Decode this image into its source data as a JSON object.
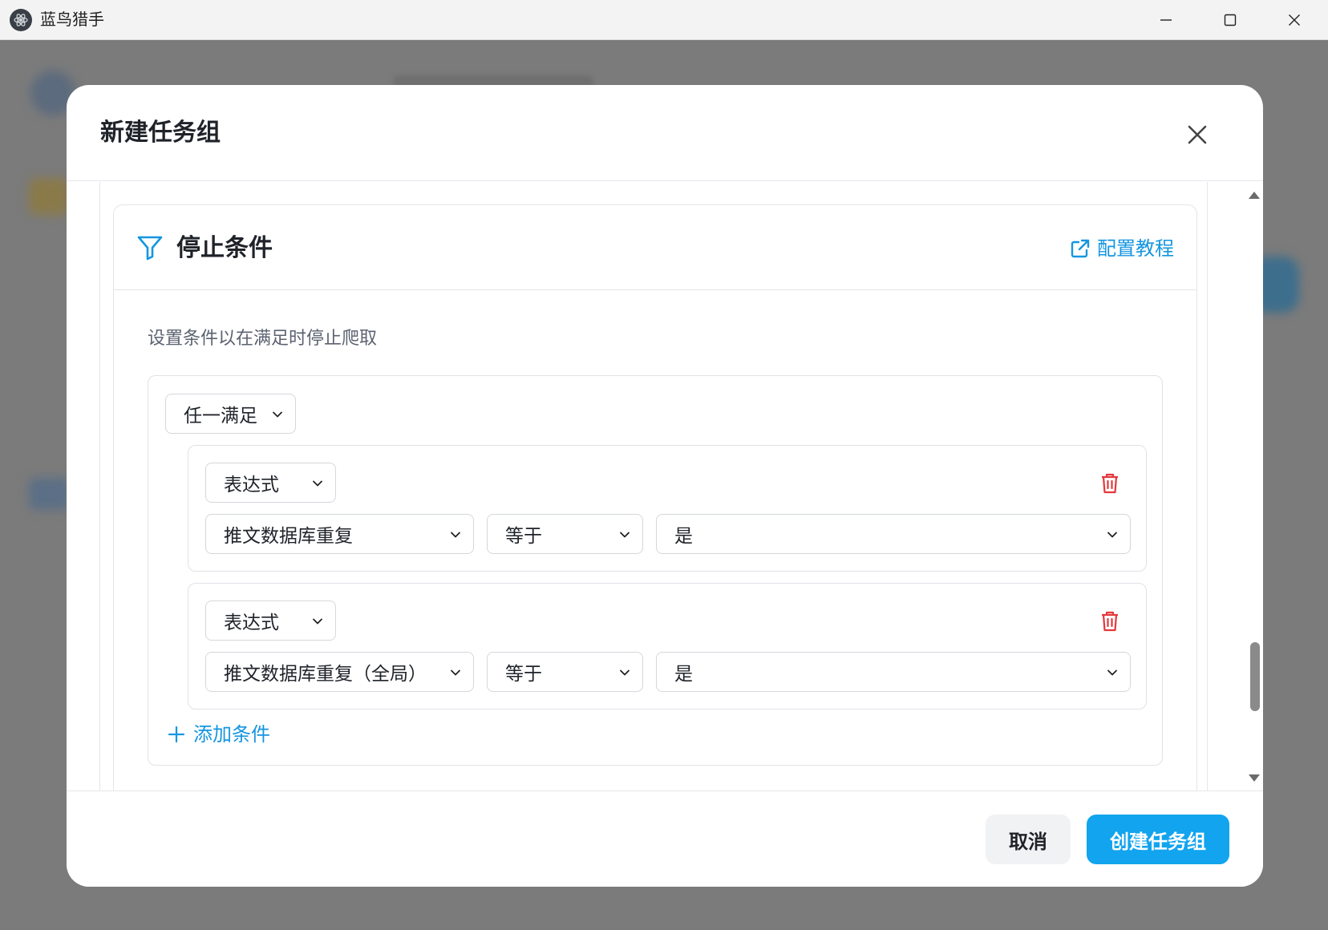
{
  "window": {
    "app_title": "蓝鸟猎手"
  },
  "modal": {
    "title": "新建任务组",
    "section": {
      "title": "停止条件",
      "tutorial_link": "配置教程",
      "description": "设置条件以在满足时停止爬取",
      "group_mode": "任一满足",
      "conditions": [
        {
          "type": "表达式",
          "field": "推文数据库重复",
          "operator": "等于",
          "value": "是"
        },
        {
          "type": "表达式",
          "field": "推文数据库重复（全局）",
          "operator": "等于",
          "value": "是"
        }
      ],
      "add_condition": "添加条件"
    },
    "footer": {
      "cancel": "取消",
      "create": "创建任务组"
    }
  },
  "colors": {
    "accent": "#12a4ee",
    "link": "#1596e0",
    "danger": "#e5383b",
    "overlay": "#7b7b7b"
  },
  "icons": [
    "app-logo-icon",
    "minimize-icon",
    "maximize-icon",
    "window-close-icon",
    "close-icon",
    "filter-icon",
    "external-link-icon",
    "chevron-down-icon",
    "trash-icon",
    "plus-icon",
    "scroll-up-icon",
    "scroll-down-icon"
  ]
}
